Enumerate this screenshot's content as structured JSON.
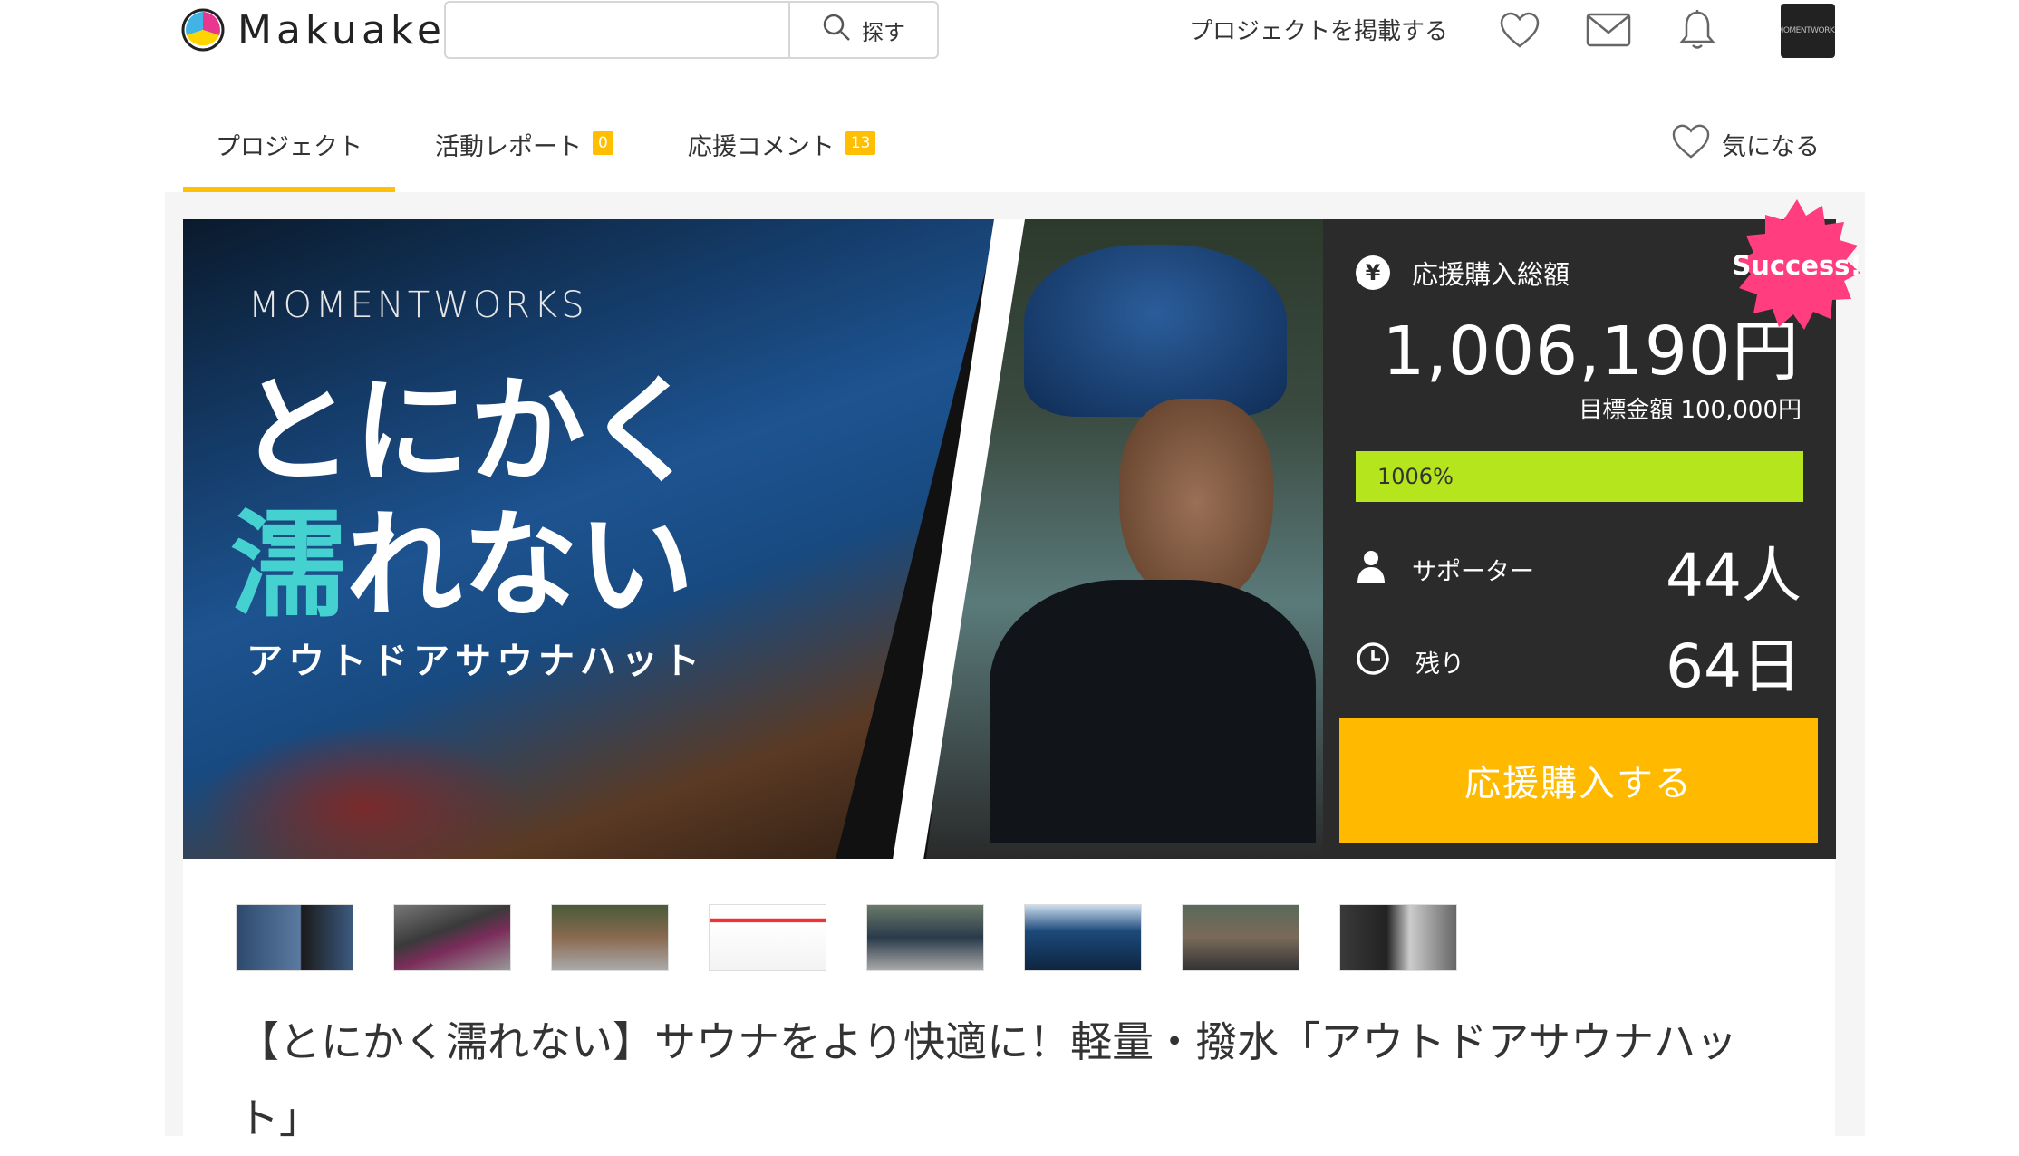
{
  "header": {
    "logo_text": "Makuake",
    "search_placeholder": "",
    "search_button": "探す",
    "post_project": "プロジェクトを掲載する",
    "avatar_text": "MOMENTWORKS"
  },
  "tabs": [
    {
      "label": "プロジェクト",
      "badge": null,
      "active": true
    },
    {
      "label": "活動レポート",
      "badge": "0"
    },
    {
      "label": "応援コメント",
      "badge": "13"
    }
  ],
  "favorite_label": "気になる",
  "hero": {
    "brand": "MOMENTWORKS",
    "catch_line1": "とにかく",
    "catch_line2_accent": "濡",
    "catch_line2_rest": "れない",
    "catch_line3": "アウトドアサウナハット"
  },
  "stats": {
    "total_label": "応援購入総額",
    "total_value": "1,006,190円",
    "goal_text": "目標金額 100,000円",
    "progress_text": "1006%",
    "progress_fraction": 1.0,
    "supporters_label": "サポーター",
    "supporters_value": "44人",
    "remaining_label": "残り",
    "remaining_value": "64日",
    "buy_button": "応援購入する",
    "success_badge": "Success!",
    "colors": {
      "panel": "#2b2b2b",
      "progress": "#b5e61d",
      "button": "#ffba00",
      "badge": "#ff3d7f",
      "tab_accent": "#ffc107"
    }
  },
  "thumbnail_count": 8,
  "project_title": "【とにかく濡れない】サウナをより快適に！軽量・撥水「アウトドアサウナハット」"
}
